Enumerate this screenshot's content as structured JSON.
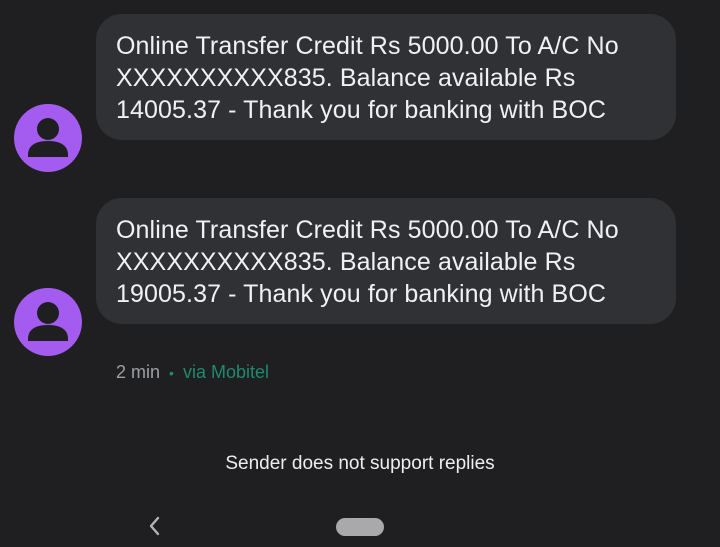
{
  "messages": [
    {
      "text": "Online Transfer Credit Rs 5000.00 To A/C No XXXXXXXXXX835. Balance available Rs 14005.37 - Thank you for banking with BOC",
      "avatar_icon": "person-icon"
    },
    {
      "text": "Online Transfer Credit Rs 5000.00 To A/C No XXXXXXXXXX835. Balance available Rs 19005.37 - Thank you for banking with BOC",
      "avatar_icon": "person-icon"
    }
  ],
  "meta": {
    "time": "2 min",
    "separator": "•",
    "via": "via Mobitel"
  },
  "notice": "Sender does not support replies",
  "nav": {
    "back_icon": "chevron-left-icon",
    "home_icon": "home-pill-icon"
  },
  "colors": {
    "background": "#1f1f21",
    "bubble": "#303134",
    "avatar": "#a45cf0",
    "via_accent": "#1e8a6e"
  }
}
